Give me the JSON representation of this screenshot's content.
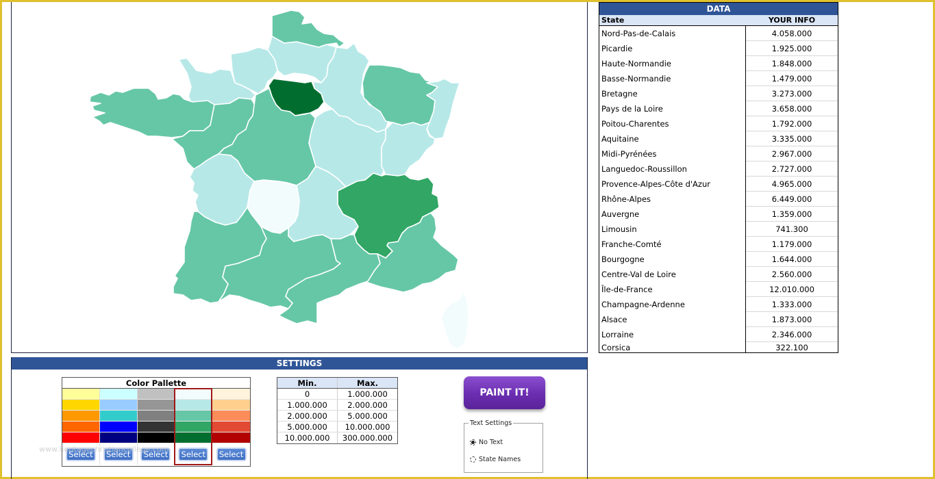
{
  "data_panel": {
    "title": "DATA",
    "col_state": "State",
    "col_info": "YOUR INFO",
    "rows": [
      {
        "state": "Nord-Pas-de-Calais",
        "value": "4.058.000"
      },
      {
        "state": "Picardie",
        "value": "1.925.000"
      },
      {
        "state": "Haute-Normandie",
        "value": "1.848.000"
      },
      {
        "state": "Basse-Normandie",
        "value": "1.479.000"
      },
      {
        "state": "Bretagne",
        "value": "3.273.000"
      },
      {
        "state": "Pays de la Loire",
        "value": "3.658.000"
      },
      {
        "state": "Poitou-Charentes",
        "value": "1.792.000"
      },
      {
        "state": "Aquitaine",
        "value": "3.335.000"
      },
      {
        "state": "Midi-Pyrénées",
        "value": "2.967.000"
      },
      {
        "state": "Languedoc-Roussillon",
        "value": "2.727.000"
      },
      {
        "state": "Provence-Alpes-Côte d'Azur",
        "value": "4.965.000"
      },
      {
        "state": "Rhône-Alpes",
        "value": "6.449.000"
      },
      {
        "state": "Auvergne",
        "value": "1.359.000"
      },
      {
        "state": "Limousin",
        "value": "741.300"
      },
      {
        "state": "Franche-Comté",
        "value": "1.179.000"
      },
      {
        "state": "Bourgogne",
        "value": "1.644.000"
      },
      {
        "state": "Centre-Val de Loire",
        "value": "2.560.000"
      },
      {
        "state": "Île-de-France",
        "value": "12.010.000"
      },
      {
        "state": "Champagne-Ardenne",
        "value": "1.333.000"
      },
      {
        "state": "Alsace",
        "value": "1.873.000"
      },
      {
        "state": "Lorraine",
        "value": "2.346.000"
      },
      {
        "state": "Corsica",
        "value": "322.100"
      }
    ]
  },
  "map": {
    "class_colors": [
      "#f3fcfd",
      "#b7e8e8",
      "#66c7a7",
      "#31a665",
      "#016e30"
    ],
    "regions": [
      {
        "name": "Nord-Pas-de-Calais",
        "class": 2
      },
      {
        "name": "Picardie",
        "class": 1
      },
      {
        "name": "Haute-Normandie",
        "class": 1
      },
      {
        "name": "Basse-Normandie",
        "class": 1
      },
      {
        "name": "Bretagne",
        "class": 2
      },
      {
        "name": "Pays de la Loire",
        "class": 2
      },
      {
        "name": "Poitou-Charentes",
        "class": 1
      },
      {
        "name": "Aquitaine",
        "class": 2
      },
      {
        "name": "Midi-Pyrénées",
        "class": 2
      },
      {
        "name": "Languedoc-Roussillon",
        "class": 2
      },
      {
        "name": "Provence-Alpes-Côte d'Azur",
        "class": 2
      },
      {
        "name": "Rhône-Alpes",
        "class": 3
      },
      {
        "name": "Auvergne",
        "class": 1
      },
      {
        "name": "Limousin",
        "class": 0
      },
      {
        "name": "Franche-Comté",
        "class": 1
      },
      {
        "name": "Bourgogne",
        "class": 1
      },
      {
        "name": "Centre-Val de Loire",
        "class": 2
      },
      {
        "name": "Île-de-France",
        "class": 4
      },
      {
        "name": "Champagne-Ardenne",
        "class": 1
      },
      {
        "name": "Alsace",
        "class": 1
      },
      {
        "name": "Lorraine",
        "class": 2
      },
      {
        "name": "Corsica",
        "class": 0
      }
    ]
  },
  "settings": {
    "title": "SETTINGS",
    "palette": {
      "title": "Color Pallette",
      "selected_index": 3,
      "columns": [
        {
          "colors": [
            "#ffff99",
            "#ffd700",
            "#ff9900",
            "#ff6600",
            "#ff0000"
          ],
          "button": "Select"
        },
        {
          "colors": [
            "#ccffff",
            "#99ccff",
            "#33cccc",
            "#0000ff",
            "#000080"
          ],
          "button": "Select"
        },
        {
          "colors": [
            "#c0c0c0",
            "#969696",
            "#808080",
            "#333333",
            "#000000"
          ],
          "button": "Select"
        },
        {
          "colors": [
            "#f3fcfd",
            "#b7e8e8",
            "#66c7a7",
            "#31a665",
            "#016e30"
          ],
          "button": "Select"
        },
        {
          "colors": [
            "#fff3dc",
            "#fdd08e",
            "#fc8d59",
            "#e34a33",
            "#b30000"
          ],
          "button": "Select"
        }
      ]
    },
    "watermark": "www.heritagechristiancollege.com",
    "ranges": {
      "col_min": "Min.",
      "col_max": "Max.",
      "rows": [
        {
          "min": "0",
          "max": "1.000.000"
        },
        {
          "min": "1.000.000",
          "max": "2.000.000"
        },
        {
          "min": "2.000.000",
          "max": "5.000.000"
        },
        {
          "min": "5.000.000",
          "max": "10.000.000"
        },
        {
          "min": "10.000.000",
          "max": "300.000.000"
        }
      ]
    },
    "paint_button": "PAINT IT!",
    "text_settings": {
      "legend": "Text Settings",
      "options": [
        {
          "label": "No Text",
          "checked": true
        },
        {
          "label": "State Names",
          "checked": false
        }
      ]
    }
  }
}
